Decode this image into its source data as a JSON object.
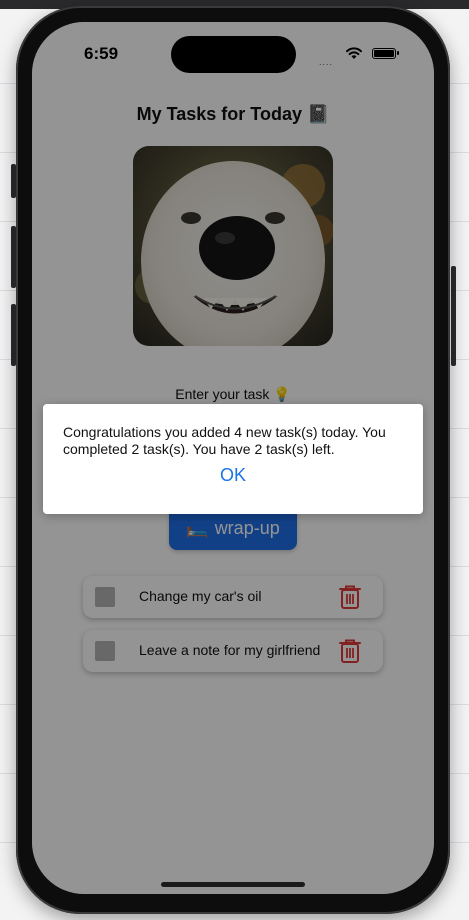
{
  "status_bar": {
    "time": "6:59",
    "signal_dots": "....",
    "wifi_icon": "wifi-icon",
    "battery_icon": "battery-full-icon"
  },
  "app": {
    "title": "My Tasks for Today 📓",
    "photo_icon": "smiling-dog-photo",
    "input_label": "Enter your task 💡",
    "wrapup_button": {
      "emoji": "🛏️",
      "label": "wrap-up"
    },
    "tasks": [
      {
        "text": "Change my car's oil",
        "checked": false
      },
      {
        "text": "Leave a note for my girlfriend",
        "checked": false
      }
    ]
  },
  "alert": {
    "message": "Congratulations you added 4 new task(s) today. You completed 2 task(s). You have 2 task(s) left.",
    "ok_label": "OK"
  },
  "colors": {
    "accent_blue": "#1f6fe8",
    "alert_link": "#1a73e8",
    "trash_red": "#e03a3a",
    "overlay": "rgba(0,0,0,0.42)"
  }
}
